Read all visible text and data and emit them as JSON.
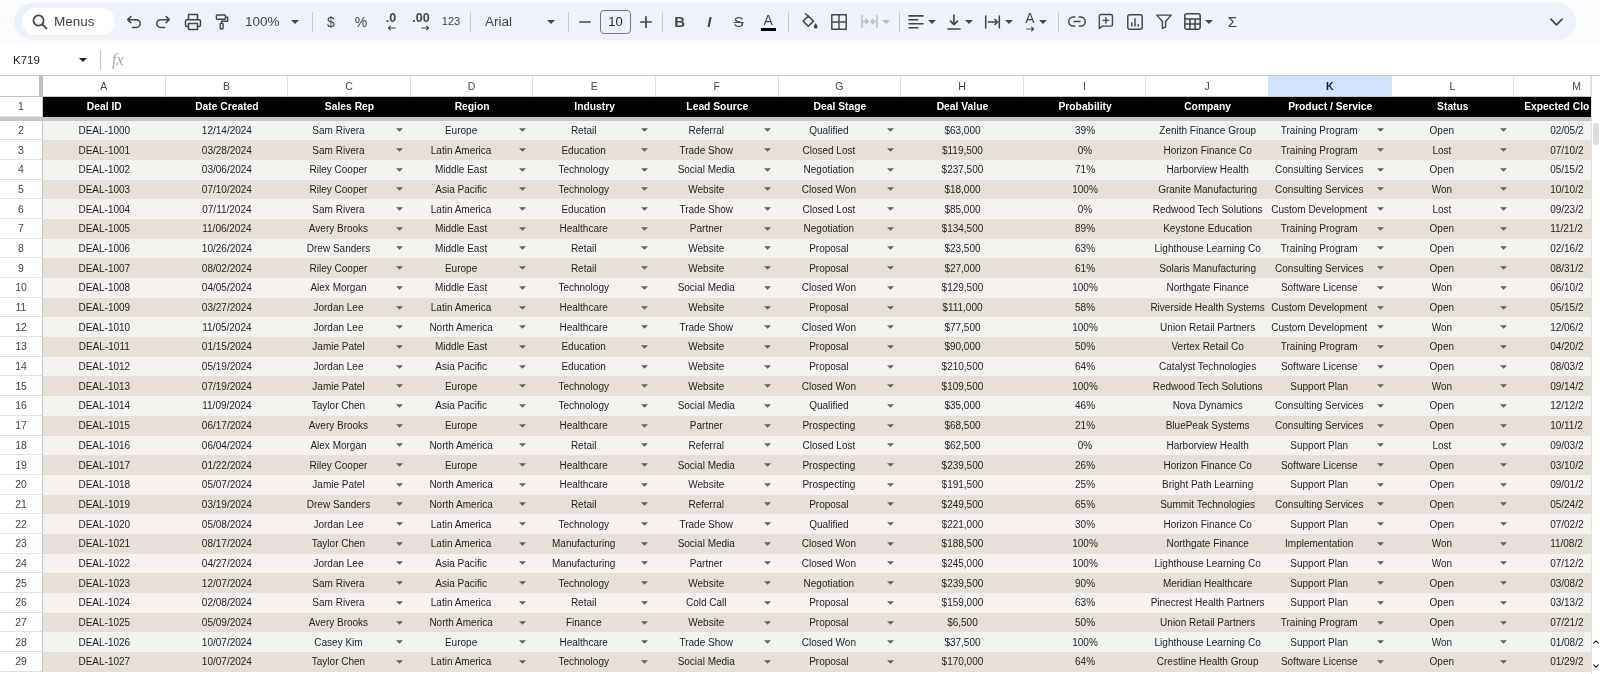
{
  "toolbar": {
    "menus_button": "Menus",
    "zoom": "100%",
    "number_formats": [
      {
        "kind": "symbol",
        "label": "$"
      },
      {
        "kind": "symbol",
        "label": "%"
      },
      {
        "kind": "decimal_decrease",
        "label": ".0"
      },
      {
        "kind": "decimal_increase",
        "label": ".00"
      },
      {
        "kind": "format_menu",
        "label": "123"
      }
    ],
    "font": "Arial",
    "font_size": "10",
    "text_styles": [
      {
        "kind": "bold",
        "label": "B"
      },
      {
        "kind": "italic",
        "label": "I"
      },
      {
        "kind": "strikethrough",
        "label": "S"
      },
      {
        "kind": "text_color",
        "label": "A"
      }
    ],
    "merge": {
      "disabled": true
    },
    "text_rotation": "A",
    "functions": "Σ"
  },
  "formula_bar": {
    "name_box": "K719",
    "formula_label": "fx"
  },
  "columns": [
    {
      "letter": "A",
      "selected": false,
      "heading": "Deal ID",
      "dropdown": false
    },
    {
      "letter": "B",
      "selected": false,
      "heading": "Date Created",
      "dropdown": false
    },
    {
      "letter": "C",
      "selected": false,
      "heading": "Sales Rep",
      "dropdown": true
    },
    {
      "letter": "D",
      "selected": false,
      "heading": "Region",
      "dropdown": true
    },
    {
      "letter": "E",
      "selected": false,
      "heading": "Industry",
      "dropdown": true
    },
    {
      "letter": "F",
      "selected": false,
      "heading": "Lead Source",
      "dropdown": true
    },
    {
      "letter": "G",
      "selected": false,
      "heading": "Deal Stage",
      "dropdown": true
    },
    {
      "letter": "H",
      "selected": false,
      "heading": "Deal Value",
      "dropdown": false
    },
    {
      "letter": "I",
      "selected": false,
      "heading": "Probability",
      "dropdown": false
    },
    {
      "letter": "J",
      "selected": false,
      "heading": "Company",
      "dropdown": false
    },
    {
      "letter": "K",
      "selected": true,
      "heading": "Product / Service",
      "dropdown": true
    },
    {
      "letter": "L",
      "selected": false,
      "heading": "Status",
      "dropdown": true
    },
    {
      "letter": "M",
      "selected": false,
      "heading": "Expected Clo",
      "dropdown": false
    }
  ],
  "header_row": {
    "number": "1"
  },
  "rows": [
    {
      "number": "2",
      "cells": [
        "DEAL-1000",
        "12/14/2024",
        "Sam Rivera",
        "Europe",
        "Retail",
        "Referral",
        "Qualified",
        "$63,000",
        "39%",
        "Zenith Finance Group",
        "Training Program",
        "Open",
        "02/05/2"
      ]
    },
    {
      "number": "3",
      "cells": [
        "DEAL-1001",
        "03/28/2024",
        "Sam Rivera",
        "Latin America",
        "Education",
        "Trade Show",
        "Closed Lost",
        "$119,500",
        "0%",
        "Horizon Finance Co",
        "Training Program",
        "Lost",
        "07/10/2"
      ]
    },
    {
      "number": "4",
      "cells": [
        "DEAL-1002",
        "03/06/2024",
        "Riley Cooper",
        "Middle East",
        "Technology",
        "Social Media",
        "Negotiation",
        "$237,500",
        "71%",
        "Harborview Health",
        "Consulting Services",
        "Open",
        "05/15/2"
      ]
    },
    {
      "number": "5",
      "cells": [
        "DEAL-1003",
        "07/10/2024",
        "Riley Cooper",
        "Asia Pacific",
        "Technology",
        "Website",
        "Closed Won",
        "$18,000",
        "100%",
        "Granite Manufacturing",
        "Consulting Services",
        "Won",
        "10/10/2"
      ]
    },
    {
      "number": "6",
      "cells": [
        "DEAL-1004",
        "07/11/2024",
        "Sam Rivera",
        "Latin America",
        "Education",
        "Trade Show",
        "Closed Lost",
        "$85,000",
        "0%",
        "Redwood Tech Solutions",
        "Custom Development",
        "Lost",
        "09/23/2"
      ]
    },
    {
      "number": "7",
      "cells": [
        "DEAL-1005",
        "11/06/2024",
        "Avery Brooks",
        "Middle East",
        "Healthcare",
        "Partner",
        "Negotiation",
        "$134,500",
        "89%",
        "Keystone Education",
        "Training Program",
        "Open",
        "11/21/2"
      ]
    },
    {
      "number": "8",
      "cells": [
        "DEAL-1006",
        "10/26/2024",
        "Drew Sanders",
        "Middle East",
        "Retail",
        "Website",
        "Proposal",
        "$23,500",
        "63%",
        "Lighthouse Learning Co",
        "Training Program",
        "Open",
        "02/16/2"
      ]
    },
    {
      "number": "9",
      "cells": [
        "DEAL-1007",
        "08/02/2024",
        "Riley Cooper",
        "Europe",
        "Retail",
        "Website",
        "Proposal",
        "$27,000",
        "61%",
        "Solaris Manufacturing",
        "Consulting Services",
        "Open",
        "08/31/2"
      ]
    },
    {
      "number": "10",
      "cells": [
        "DEAL-1008",
        "04/05/2024",
        "Alex Morgan",
        "Middle East",
        "Technology",
        "Social Media",
        "Closed Won",
        "$129,500",
        "100%",
        "Northgate Finance",
        "Software License",
        "Won",
        "06/10/2"
      ]
    },
    {
      "number": "11",
      "cells": [
        "DEAL-1009",
        "03/27/2024",
        "Jordan Lee",
        "Latin America",
        "Healthcare",
        "Website",
        "Proposal",
        "$111,000",
        "58%",
        "Riverside Health Systems",
        "Custom Development",
        "Open",
        "05/15/2"
      ]
    },
    {
      "number": "12",
      "cells": [
        "DEAL-1010",
        "11/05/2024",
        "Jordan Lee",
        "North America",
        "Healthcare",
        "Trade Show",
        "Closed Won",
        "$77,500",
        "100%",
        "Union Retail Partners",
        "Custom Development",
        "Won",
        "12/06/2"
      ]
    },
    {
      "number": "13",
      "cells": [
        "DEAL-1011",
        "01/15/2024",
        "Jamie Patel",
        "Middle East",
        "Education",
        "Website",
        "Proposal",
        "$90,000",
        "50%",
        "Vertex Retail Co",
        "Training Program",
        "Open",
        "04/20/2"
      ]
    },
    {
      "number": "14",
      "cells": [
        "DEAL-1012",
        "05/19/2024",
        "Jordan Lee",
        "Asia Pacific",
        "Education",
        "Website",
        "Proposal",
        "$210,500",
        "64%",
        "Catalyst Technologies",
        "Software License",
        "Open",
        "08/03/2"
      ]
    },
    {
      "number": "15",
      "cells": [
        "DEAL-1013",
        "07/19/2024",
        "Jamie Patel",
        "Europe",
        "Technology",
        "Website",
        "Closed Won",
        "$109,500",
        "100%",
        "Redwood Tech Solutions",
        "Support Plan",
        "Won",
        "09/14/2"
      ]
    },
    {
      "number": "16",
      "cells": [
        "DEAL-1014",
        "11/09/2024",
        "Taylor Chen",
        "Asia Pacific",
        "Technology",
        "Social Media",
        "Qualified",
        "$35,000",
        "46%",
        "Nova Dynamics",
        "Consulting Services",
        "Open",
        "12/12/2"
      ]
    },
    {
      "number": "17",
      "cells": [
        "DEAL-1015",
        "06/17/2024",
        "Avery Brooks",
        "Europe",
        "Healthcare",
        "Partner",
        "Prospecting",
        "$68,500",
        "21%",
        "BluePeak Systems",
        "Consulting Services",
        "Open",
        "10/11/2"
      ]
    },
    {
      "number": "18",
      "cells": [
        "DEAL-1016",
        "06/04/2024",
        "Alex Morgan",
        "North America",
        "Retail",
        "Referral",
        "Closed Lost",
        "$62,500",
        "0%",
        "Harborview Health",
        "Support Plan",
        "Lost",
        "09/03/2"
      ]
    },
    {
      "number": "19",
      "cells": [
        "DEAL-1017",
        "01/22/2024",
        "Riley Cooper",
        "Europe",
        "Healthcare",
        "Social Media",
        "Prospecting",
        "$239,500",
        "26%",
        "Horizon Finance Co",
        "Software License",
        "Open",
        "03/10/2"
      ]
    },
    {
      "number": "20",
      "cells": [
        "DEAL-1018",
        "05/07/2024",
        "Jamie Patel",
        "North America",
        "Healthcare",
        "Website",
        "Prospecting",
        "$191,500",
        "25%",
        "Bright Path Learning",
        "Support Plan",
        "Open",
        "09/01/2"
      ]
    },
    {
      "number": "21",
      "cells": [
        "DEAL-1019",
        "03/19/2024",
        "Drew Sanders",
        "North America",
        "Retail",
        "Referral",
        "Proposal",
        "$249,500",
        "65%",
        "Summit Technologies",
        "Consulting Services",
        "Open",
        "05/24/2"
      ]
    },
    {
      "number": "22",
      "cells": [
        "DEAL-1020",
        "05/08/2024",
        "Jordan Lee",
        "Latin America",
        "Technology",
        "Trade Show",
        "Qualified",
        "$221,000",
        "30%",
        "Horizon Finance Co",
        "Support Plan",
        "Open",
        "07/02/2"
      ]
    },
    {
      "number": "23",
      "cells": [
        "DEAL-1021",
        "08/17/2024",
        "Taylor Chen",
        "Latin America",
        "Manufacturing",
        "Social Media",
        "Closed Won",
        "$188,500",
        "100%",
        "Northgate Finance",
        "Implementation",
        "Won",
        "11/08/2"
      ]
    },
    {
      "number": "24",
      "cells": [
        "DEAL-1022",
        "04/27/2024",
        "Jordan Lee",
        "Asia Pacific",
        "Manufacturing",
        "Partner",
        "Closed Won",
        "$245,000",
        "100%",
        "Lighthouse Learning Co",
        "Support Plan",
        "Won",
        "07/12/2"
      ]
    },
    {
      "number": "25",
      "cells": [
        "DEAL-1023",
        "12/07/2024",
        "Sam Rivera",
        "Asia Pacific",
        "Technology",
        "Website",
        "Negotiation",
        "$239,500",
        "90%",
        "Meridian Healthcare",
        "Support Plan",
        "Open",
        "03/08/2"
      ]
    },
    {
      "number": "26",
      "cells": [
        "DEAL-1024",
        "02/08/2024",
        "Sam Rivera",
        "Latin America",
        "Retail",
        "Cold Call",
        "Proposal",
        "$159,000",
        "63%",
        "Pinecrest Health Partners",
        "Support Plan",
        "Open",
        "03/13/2"
      ]
    },
    {
      "number": "27",
      "cells": [
        "DEAL-1025",
        "05/09/2024",
        "Avery Brooks",
        "North America",
        "Finance",
        "Website",
        "Proposal",
        "$6,500",
        "50%",
        "Union Retail Partners",
        "Training Program",
        "Open",
        "07/21/2"
      ]
    },
    {
      "number": "28",
      "cells": [
        "DEAL-1026",
        "10/07/2024",
        "Casey Kim",
        "Europe",
        "Healthcare",
        "Trade Show",
        "Closed Won",
        "$37,500",
        "100%",
        "Lighthouse Learning Co",
        "Support Plan",
        "Won",
        "01/08/2"
      ]
    },
    {
      "number": "29",
      "cells": [
        "DEAL-1027",
        "10/07/2024",
        "Taylor Chen",
        "Latin America",
        "Technology",
        "Social Media",
        "Proposal",
        "$170,000",
        "64%",
        "Crestline Health Group",
        "Software License",
        "Open",
        "01/29/2"
      ]
    }
  ]
}
